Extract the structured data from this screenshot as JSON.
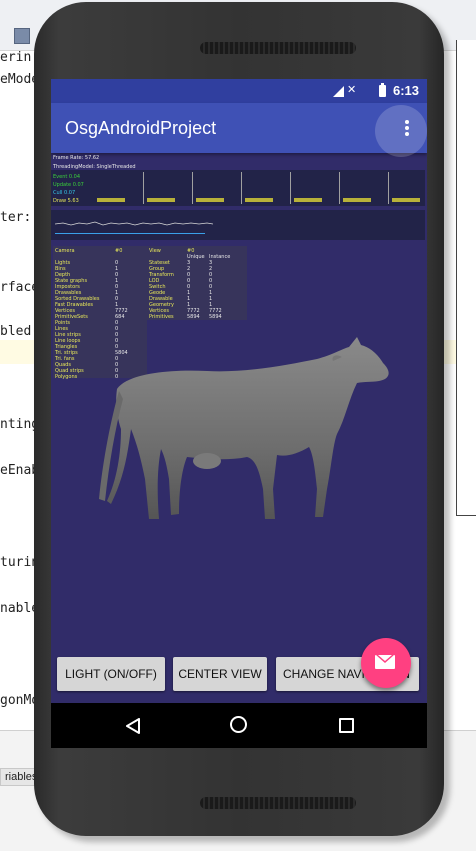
{
  "app": {
    "title": "OsgAndroidProject",
    "status_time": "6:13"
  },
  "colors": {
    "appbar": "#3f51b5",
    "statusbar": "#303f9f",
    "scene_background": "#312c69",
    "fab": "#ff4081",
    "button": "#d6d6d6"
  },
  "icons": {
    "menu": "more-vert-icon",
    "fab": "email-icon",
    "signal": "signal-icon",
    "battery": "battery-charging-icon",
    "nav_back": "back-icon",
    "nav_home": "home-icon",
    "nav_recent": "recent-apps-icon"
  },
  "ide": {
    "code_fragments": [
      "erin",
      "eMode",
      "ter::",
      "rface",
      "bled(",
      "nting",
      "eEnab",
      "turin",
      "nable",
      "gonMo"
    ],
    "bottom_tab": "riables"
  },
  "stats": {
    "frame_rate": "Frame Rate: 57.62",
    "threading": "ThreadingModel: SingleThreaded",
    "event": "Event 0.04",
    "update": "Update 0.07",
    "cull": "Cull 0.07",
    "draw": "Draw 5.63"
  },
  "camera_stats": {
    "header_label": "Camera",
    "header_value": "#0",
    "rows": [
      {
        "label": "Lights",
        "value": "0"
      },
      {
        "label": "Bins",
        "value": "1"
      },
      {
        "label": "Depth",
        "value": "0"
      },
      {
        "label": "State graphs",
        "value": "1"
      },
      {
        "label": "Impostors",
        "value": "0"
      },
      {
        "label": "Drawables",
        "value": "1"
      },
      {
        "label": "Sorted Drawables",
        "value": "0"
      },
      {
        "label": "Fast Drawables",
        "value": "1"
      },
      {
        "label": "Vertices",
        "value": "7772"
      },
      {
        "label": "PrimitiveSets",
        "value": "684"
      },
      {
        "label": "Points",
        "value": "0"
      },
      {
        "label": "Lines",
        "value": "0"
      },
      {
        "label": "Line strips",
        "value": "0"
      },
      {
        "label": "Line loops",
        "value": "0"
      },
      {
        "label": "Triangles",
        "value": "0"
      },
      {
        "label": "Tri. strips",
        "value": "5804"
      },
      {
        "label": "Tri. fans",
        "value": "0"
      },
      {
        "label": "Quads",
        "value": "0"
      },
      {
        "label": "Quad strips",
        "value": "0"
      },
      {
        "label": "Polygons",
        "value": "0"
      }
    ]
  },
  "view_stats": {
    "header_label": "View",
    "header_value": "#0",
    "col_unique": "Unique",
    "col_instance": "Instance",
    "rows": [
      {
        "label": "Stateset",
        "unique": "3",
        "instance": "3"
      },
      {
        "label": "Group",
        "unique": "2",
        "instance": "2"
      },
      {
        "label": "Transform",
        "unique": "0",
        "instance": "0"
      },
      {
        "label": "LOD",
        "unique": "0",
        "instance": "0"
      },
      {
        "label": "Switch",
        "unique": "0",
        "instance": "0"
      },
      {
        "label": "Geode",
        "unique": "1",
        "instance": "1"
      },
      {
        "label": "Drawable",
        "unique": "1",
        "instance": "1"
      },
      {
        "label": "Geometry",
        "unique": "1",
        "instance": "1"
      },
      {
        "label": "Vertices",
        "unique": "7772",
        "instance": "7772"
      },
      {
        "label": "Primitives",
        "unique": "5894",
        "instance": "5894"
      }
    ]
  },
  "buttons": {
    "light": "LIGHT (ON/OFF)",
    "center": "CENTER VIEW",
    "navigation": "CHANGE NAVIGATION"
  }
}
